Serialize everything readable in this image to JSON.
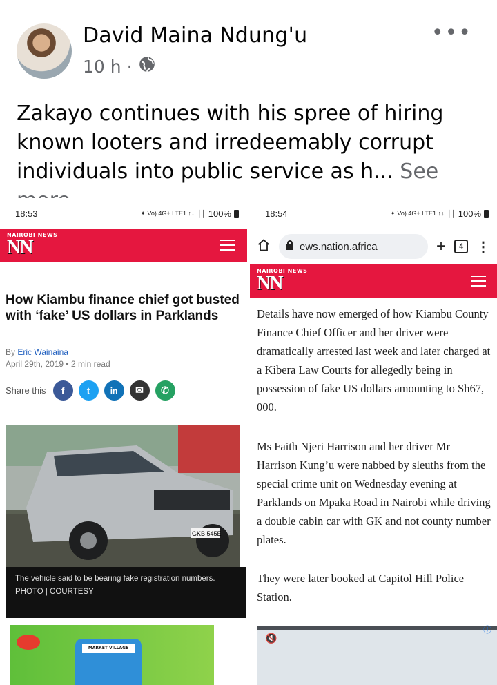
{
  "post": {
    "author": "David Maina Ndung'u",
    "time": "10 h",
    "separator": "·",
    "text": "Zakayo continues with his spree of hiring known looters and irredeemably corrupt individuals into public service as h...",
    "see_more": "See more",
    "more_icon": "•••"
  },
  "left_shot": {
    "status_time": "18:53",
    "status_icons": "✦ Vo) 4G+ LTE1 ↑↓ .││",
    "battery": "100%",
    "logo_top": "NAIROBI NEWS",
    "logo_nn": "NN",
    "headline": "How Kiambu finance chief got busted with ‘fake’ US dollars in Parklands",
    "by_label": "By",
    "author": "Eric Wainaina",
    "date": "April 29th, 2019",
    "dot": "•",
    "read_time": "2 min read",
    "share_label": "Share this",
    "share_icons": {
      "facebook": "f",
      "twitter": "t",
      "linkedin": "in",
      "email": "✉",
      "whatsapp": "✆"
    },
    "plate": "GKB 545E",
    "caption": "The vehicle said to be bearing fake registration numbers. PHOTO | COURTESY",
    "ad_text": "MARKET VILLAGE"
  },
  "right_shot": {
    "status_time": "18:54",
    "status_icons": "✦ Vo) 4G+ LTE1 ↑↓ .││",
    "battery": "100%",
    "url": "ews.nation.africa",
    "tab_count": "4",
    "logo_top": "NAIROBI NEWS",
    "logo_nn": "NN",
    "paragraphs": [
      "Details have now emerged of how Kiambu County Finance Chief Officer and her driver were dramatically arrested last week and later charged at a Kibera Law Courts for allegedly being in possession of fake US dollars amounting to Sh67, 000.",
      "Ms Faith Njeri Harrison and her driver Mr Harrison Kung’u were nabbed by sleuths from the special crime unit on Wednesday evening at Parklands on Mpaka Road in Nairobi while driving a double cabin car with GK and not county number plates.",
      "They were later booked at Capitol Hill Police Station."
    ]
  },
  "colors": {
    "brand_red": "#e5173f",
    "facebook": "#3b5998",
    "twitter": "#1da1f2",
    "linkedin": "#1172b7",
    "email": "#333333",
    "whatsapp": "#25a162"
  }
}
